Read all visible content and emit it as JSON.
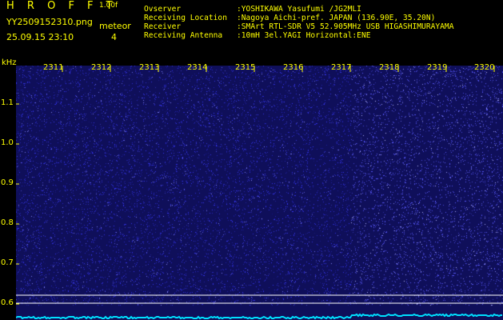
{
  "header": {
    "app_title": "H R O F F T",
    "version": "1.00f",
    "filename": "YY2509152310.png",
    "timestamp": "25.09.15 23:10",
    "detection_label": "meteor",
    "detection_count": "4"
  },
  "station_info": [
    {
      "label": "Ovserver",
      "value": ":YOSHIKAWA Yasufumi /JG2MLI"
    },
    {
      "label": "Receiving Location",
      "value": ":Nagoya Aichi-pref. JAPAN (136.90E, 35.20N)"
    },
    {
      "label": "Receiver",
      "value": ":SMArt RTL-SDR V5 52.905MHz USB HIGASHIMURAYAMA"
    },
    {
      "label": "Receiving Antenna",
      "value": ":10mH 3el.YAGI Horizontal:ENE"
    }
  ],
  "plot": {
    "y_unit": "kHz",
    "x_ticks": [
      "2311",
      "2312",
      "2313",
      "2314",
      "2315",
      "2316",
      "2317",
      "2318",
      "2319",
      "2320"
    ],
    "y_ticks": [
      "1.1",
      "1.0",
      "0.9",
      "0.8",
      "0.7",
      "0.6"
    ],
    "colors": {
      "background": "#0f0f5a",
      "noise": "#3a3aff",
      "bright_noise": "#5a5aff",
      "baseline": "#00e0ff",
      "gridline": "#ffffff",
      "text": "#ffff00"
    }
  }
}
